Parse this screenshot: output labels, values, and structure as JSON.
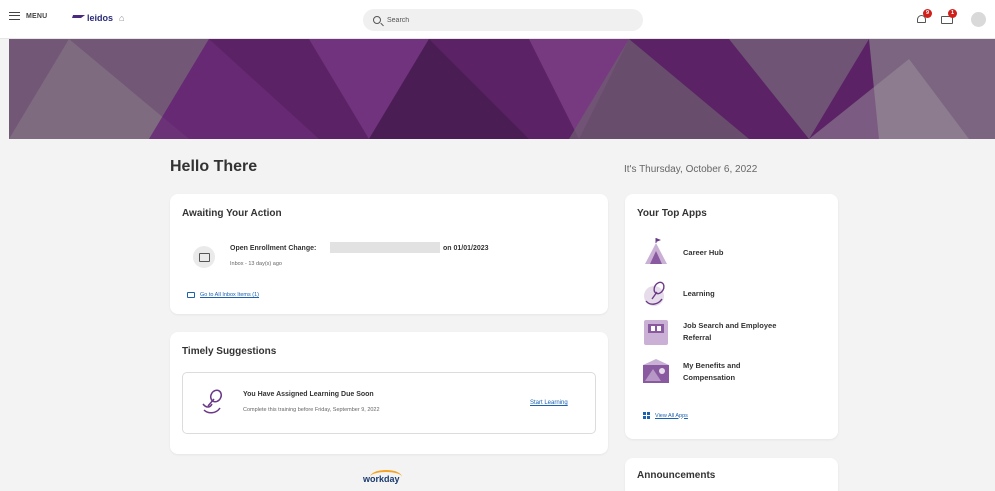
{
  "topbar": {
    "menu_label": "MENU",
    "logo_text": "leidos",
    "search_placeholder": "Search",
    "notifications_count": "9",
    "inbox_count": "1"
  },
  "greeting": "Hello There",
  "date_text": "It's Thursday, October 6, 2022",
  "awaiting": {
    "title": "Awaiting Your Action",
    "item_title": "Open Enrollment Change:",
    "item_date": "on 01/01/2023",
    "item_sub": "Inbox - 13 day(s) ago",
    "inbox_link": "Go to All Inbox Items (1)"
  },
  "timely": {
    "title": "Timely Suggestions",
    "suggestion_title": "You Have Assigned Learning Due Soon",
    "suggestion_sub": "Complete this training before Friday, September 9, 2022",
    "action_label": "Start Learning"
  },
  "top_apps": {
    "title": "Your Top Apps",
    "apps": [
      {
        "label": "Career Hub",
        "icon": "career-hub-icon"
      },
      {
        "label": "Learning",
        "icon": "learning-icon"
      },
      {
        "label": "Job Search and Employee Referral",
        "icon": "job-search-icon"
      },
      {
        "label": "My Benefits and Compensation",
        "icon": "benefits-icon"
      }
    ],
    "view_all": "View All Apps"
  },
  "announcements": {
    "title": "Announcements"
  },
  "footer_logo": "workday",
  "colors": {
    "brand_purple": "#5b2366",
    "link_blue": "#1a62b0",
    "badge_red": "#d0201c"
  }
}
